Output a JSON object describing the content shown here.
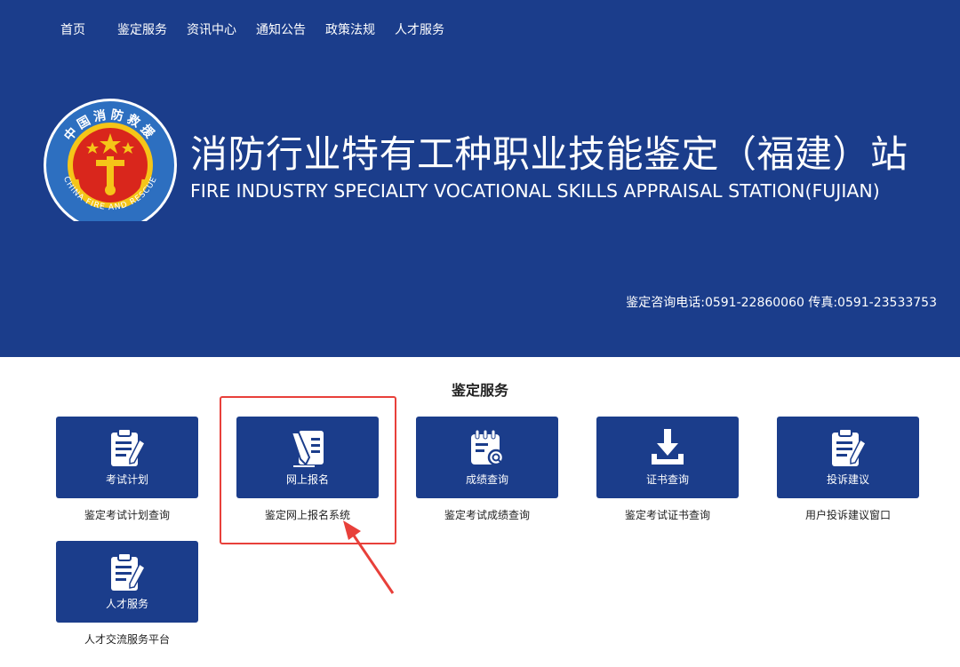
{
  "nav": {
    "items": [
      "首页",
      "鉴定服务",
      "资讯中心",
      "通知公告",
      "政策法规",
      "人才服务"
    ]
  },
  "emblem": {
    "top_text": "中国消防救援",
    "bottom_text": "CHINA FIRE AND RESCUE"
  },
  "header": {
    "title": "消防行业特有工种职业技能鉴定（福建）站",
    "subtitle": "FIRE INDUSTRY SPECIALTY VOCATIONAL SKILLS APPRAISAL STATION(FUJIAN)",
    "contact": "鉴定咨询电话:0591-22860060 传真:0591-23533753"
  },
  "services": {
    "title": "鉴定服务",
    "cards": [
      {
        "label": "考试计划",
        "desc": "鉴定考试计划查询",
        "icon": "clipboard-icon"
      },
      {
        "label": "网上报名",
        "desc": "鉴定网上报名系统",
        "icon": "sign-up-icon"
      },
      {
        "label": "成绩查询",
        "desc": "鉴定考试成绩查询",
        "icon": "calendar-search-icon"
      },
      {
        "label": "证书查询",
        "desc": "鉴定考试证书查询",
        "icon": "download-tray-icon"
      },
      {
        "label": "投诉建议",
        "desc": "用户投诉建议窗口",
        "icon": "clipboard-icon"
      },
      {
        "label": "人才服务",
        "desc": "人才交流服务平台",
        "icon": "clipboard-icon"
      }
    ]
  },
  "colors": {
    "header_bg": "#1b3d8b",
    "card_bg": "#1b3d8b",
    "highlight": "#e8403a",
    "emblem_red": "#d9261c",
    "emblem_gold": "#f5c518"
  }
}
